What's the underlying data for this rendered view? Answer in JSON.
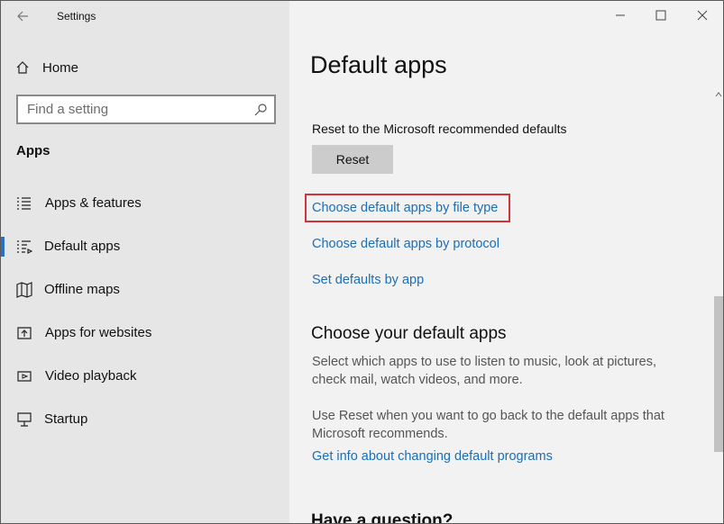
{
  "window": {
    "title": "Settings"
  },
  "sidebar": {
    "home_label": "Home",
    "search_placeholder": "Find a setting",
    "section_title": "Apps",
    "items": [
      {
        "label": "Apps & features",
        "icon": "list-icon",
        "active": false
      },
      {
        "label": "Default apps",
        "icon": "default-apps-icon",
        "active": true
      },
      {
        "label": "Offline maps",
        "icon": "map-icon",
        "active": false
      },
      {
        "label": "Apps for websites",
        "icon": "open-in-app-icon",
        "active": false
      },
      {
        "label": "Video playback",
        "icon": "video-icon",
        "active": false
      },
      {
        "label": "Startup",
        "icon": "startup-icon",
        "active": false
      }
    ]
  },
  "main": {
    "title": "Default apps",
    "reset_description": "Reset to the Microsoft recommended defaults",
    "reset_button": "Reset",
    "links": {
      "by_file_type": "Choose default apps by file type",
      "by_protocol": "Choose default apps by protocol",
      "by_app": "Set defaults by app",
      "info": "Get info about changing default programs"
    },
    "choose_heading": "Choose your default apps",
    "choose_text": "Select which apps to use to listen to music, look at pictures, check mail, watch videos, and more.",
    "reset_text": "Use Reset when you want to go back to the default apps that Microsoft recommends.",
    "question_heading": "Have a question?"
  },
  "colors": {
    "accent": "#2a6fc9",
    "link": "#1a6eb8",
    "highlight": "#d13438"
  }
}
